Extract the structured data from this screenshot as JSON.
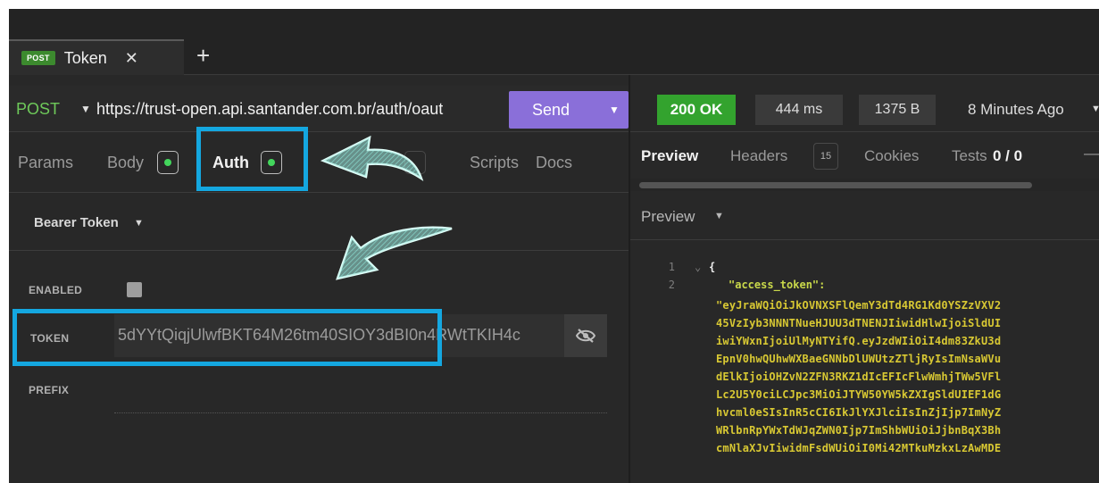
{
  "tab": {
    "method": "POST",
    "title": "Token",
    "close": "✕",
    "add": "+"
  },
  "request": {
    "method": "POST",
    "url": "https://trust-open.api.santander.com.br/auth/oaut",
    "send_label": "Send"
  },
  "request_tabs": {
    "params": "Params",
    "body": "Body",
    "auth": "Auth",
    "scripts": "Scripts",
    "docs": "Docs"
  },
  "auth": {
    "type": "Bearer Token",
    "enabled_label": "ENABLED",
    "enabled": false,
    "token_label": "TOKEN",
    "token_value": "5dYYtQiqjUlwfBKT64M26tm40SIOY3dBI0n4RWtTKIH4c",
    "prefix_label": "PREFIX"
  },
  "response": {
    "status": "200 OK",
    "time": "444 ms",
    "size": "1375 B",
    "age": "8 Minutes Ago"
  },
  "response_tabs": {
    "preview": "Preview",
    "headers": "Headers",
    "headers_count": "15",
    "cookies": "Cookies",
    "tests": "Tests",
    "tests_count": "0 / 0",
    "more": "—"
  },
  "preview": {
    "mode": "Preview",
    "line1": "1",
    "line2": "2",
    "fold": "⌄",
    "brace": "{",
    "key": "\"access_token\":",
    "token_lines": [
      "\"eyJraWQiOiJkOVNXSFlQemY3dTd4RG1Kd0YSZzVXV2",
      "45VzIyb3NNNTNueHJUU3dTNENJIiwidHlwIjoiSldUI",
      "iwiYWxnIjoiUlMyNTYifQ.eyJzdWIiOiI4dm83ZkU3d",
      "EpnV0hwQUhwWXBaeGNNbDlUWUtzZTljRyIsImNsaWVu",
      "dElkIjoiOHZvN2ZFN3RKZ1dIcEFIcFlwWmhjTWw5VFl",
      "Lc2U5Y0ciLCJpc3MiOiJTYW50YW5kZXIgSldUIEF1dG",
      "hvcml0eSIsInR5cCI6IkJlYXJlciIsInZjIjp7ImNyZ",
      "WRlbnRpYWxTdWJqZWN0Ijp7ImShbWUiOiJjbnBqX3Bh",
      "cmNlaXJvIiwidmFsdWUiOiI0Mi42MTkuMzkxLzAwMDE"
    ]
  },
  "colors": {
    "accent": "#8a6fd9",
    "method_get_post": "#6ec95a",
    "status_ok": "#33a32e",
    "highlight": "#14a7e0",
    "arrow": "#8fded2"
  }
}
